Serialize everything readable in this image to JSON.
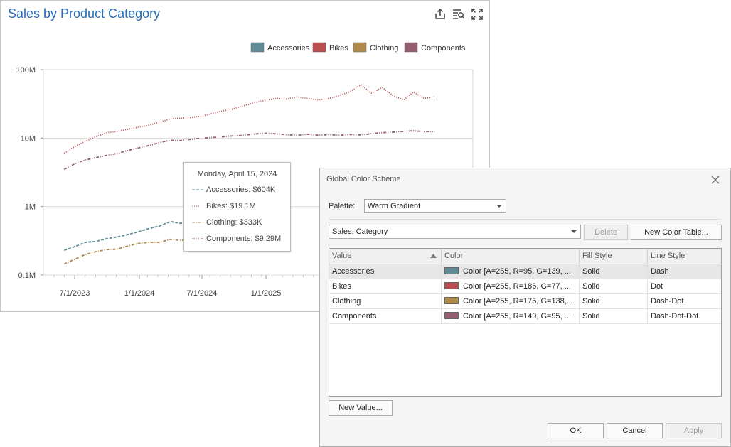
{
  "chart_panel": {
    "title": "Sales by Product Category",
    "icons": [
      "export-icon",
      "inspect-data-icon",
      "maximize-icon"
    ]
  },
  "chart_data": {
    "type": "line",
    "title": "Sales by Product Category",
    "y_scale": "log",
    "ylim": [
      100000,
      100000000
    ],
    "y_ticks": [
      {
        "value": 100000,
        "label": "0.1M"
      },
      {
        "value": 1000000,
        "label": "1M"
      },
      {
        "value": 10000000,
        "label": "10M"
      },
      {
        "value": 100000000,
        "label": "100M"
      }
    ],
    "x_ticks": [
      "7/1/2023",
      "1/1/2024",
      "7/1/2024",
      "1/1/2025"
    ],
    "grid": true,
    "legend_placement": "top-right",
    "series": [
      {
        "name": "Accessories",
        "color": "#5f8c96",
        "dash": "dash",
        "points": [
          [
            "2023-06-01",
            230000
          ],
          [
            "2023-07-01",
            260000
          ],
          [
            "2023-08-01",
            300000
          ],
          [
            "2023-09-01",
            310000
          ],
          [
            "2023-10-01",
            340000
          ],
          [
            "2023-11-01",
            360000
          ],
          [
            "2023-12-01",
            390000
          ],
          [
            "2024-01-01",
            430000
          ],
          [
            "2024-02-01",
            480000
          ],
          [
            "2024-03-01",
            520000
          ],
          [
            "2024-04-01",
            604000
          ],
          [
            "2024-05-01",
            570000
          ],
          [
            "2024-06-01",
            610000
          ],
          [
            "2024-07-01",
            640000
          ]
        ]
      },
      {
        "name": "Bikes",
        "color": "#ba4d4f",
        "dash": "dot",
        "points": [
          [
            "2023-06-01",
            6000000
          ],
          [
            "2023-07-01",
            7500000
          ],
          [
            "2023-08-01",
            9000000
          ],
          [
            "2023-09-01",
            10500000
          ],
          [
            "2023-10-01",
            12000000
          ],
          [
            "2023-11-01",
            12500000
          ],
          [
            "2023-12-01",
            13500000
          ],
          [
            "2024-01-01",
            14500000
          ],
          [
            "2024-02-01",
            15500000
          ],
          [
            "2024-03-01",
            17000000
          ],
          [
            "2024-04-01",
            19100000
          ],
          [
            "2024-05-01",
            19500000
          ],
          [
            "2024-06-01",
            20000000
          ],
          [
            "2024-07-01",
            21000000
          ],
          [
            "2024-08-01",
            23000000
          ],
          [
            "2024-09-01",
            25000000
          ],
          [
            "2024-10-01",
            27000000
          ],
          [
            "2024-11-01",
            30000000
          ],
          [
            "2024-12-01",
            33000000
          ],
          [
            "2025-01-01",
            36000000
          ],
          [
            "2025-02-01",
            38000000
          ],
          [
            "2025-03-01",
            37000000
          ],
          [
            "2025-04-01",
            40000000
          ],
          [
            "2025-05-01",
            38000000
          ],
          [
            "2025-06-01",
            36000000
          ],
          [
            "2025-07-01",
            38000000
          ],
          [
            "2025-08-01",
            42000000
          ],
          [
            "2025-09-01",
            48000000
          ],
          [
            "2025-10-01",
            60000000
          ],
          [
            "2025-11-01",
            45000000
          ],
          [
            "2025-12-01",
            55000000
          ],
          [
            "2026-01-01",
            42000000
          ],
          [
            "2026-02-01",
            36000000
          ],
          [
            "2026-03-01",
            47000000
          ],
          [
            "2026-04-01",
            38000000
          ],
          [
            "2026-05-01",
            40000000
          ]
        ]
      },
      {
        "name": "Clothing",
        "color": "#af8a4b",
        "dash": "dash-dot",
        "points": [
          [
            "2023-06-01",
            145000
          ],
          [
            "2023-07-01",
            170000
          ],
          [
            "2023-08-01",
            200000
          ],
          [
            "2023-09-01",
            220000
          ],
          [
            "2023-10-01",
            235000
          ],
          [
            "2023-11-01",
            240000
          ],
          [
            "2023-12-01",
            265000
          ],
          [
            "2024-01-01",
            290000
          ],
          [
            "2024-02-01",
            300000
          ],
          [
            "2024-03-01",
            300000
          ],
          [
            "2024-04-01",
            333000
          ],
          [
            "2024-05-01",
            320000
          ],
          [
            "2024-06-01",
            330000
          ],
          [
            "2024-07-01",
            340000
          ],
          [
            "2025-01-01",
            1200000
          ],
          [
            "2025-02-01",
            1600000
          ],
          [
            "2025-03-01",
            2200000
          ]
        ]
      },
      {
        "name": "Components",
        "color": "#955f72",
        "dash": "dash-dot-dot",
        "points": [
          [
            "2023-06-01",
            3500000
          ],
          [
            "2023-07-01",
            4200000
          ],
          [
            "2023-08-01",
            4800000
          ],
          [
            "2023-09-01",
            5200000
          ],
          [
            "2023-10-01",
            5600000
          ],
          [
            "2023-11-01",
            6000000
          ],
          [
            "2023-12-01",
            6600000
          ],
          [
            "2024-01-01",
            7200000
          ],
          [
            "2024-02-01",
            7800000
          ],
          [
            "2024-03-01",
            8600000
          ],
          [
            "2024-04-01",
            9290000
          ],
          [
            "2024-05-01",
            9200000
          ],
          [
            "2024-06-01",
            9600000
          ],
          [
            "2024-07-01",
            10000000
          ],
          [
            "2024-08-01",
            10200000
          ],
          [
            "2024-09-01",
            10500000
          ],
          [
            "2024-10-01",
            10800000
          ],
          [
            "2024-11-01",
            11000000
          ],
          [
            "2024-12-01",
            11500000
          ],
          [
            "2025-01-01",
            11800000
          ],
          [
            "2025-02-01",
            11500000
          ],
          [
            "2025-03-01",
            11200000
          ],
          [
            "2025-04-01",
            11000000
          ],
          [
            "2025-05-01",
            11400000
          ],
          [
            "2025-06-01",
            11000000
          ],
          [
            "2025-07-01",
            11200000
          ],
          [
            "2025-08-01",
            11000000
          ],
          [
            "2025-09-01",
            11300000
          ],
          [
            "2025-10-01",
            11100000
          ],
          [
            "2025-11-01",
            11600000
          ],
          [
            "2025-12-01",
            12000000
          ],
          [
            "2026-01-01",
            12200000
          ],
          [
            "2026-02-01",
            12500000
          ],
          [
            "2026-03-01",
            12800000
          ],
          [
            "2026-04-01",
            12400000
          ],
          [
            "2026-05-01",
            12500000
          ]
        ]
      }
    ]
  },
  "tooltip": {
    "date": "Monday, April 15, 2024",
    "rows": [
      {
        "series": "Accessories",
        "text": "Accessories: $604K"
      },
      {
        "series": "Bikes",
        "text": "Bikes: $19.1M"
      },
      {
        "series": "Clothing",
        "text": "Clothing: $333K"
      },
      {
        "series": "Components",
        "text": "Components: $9.29M"
      }
    ]
  },
  "dialog": {
    "title": "Global Color Scheme",
    "palette_label": "Palette:",
    "palette_value": "Warm Gradient",
    "dimension_value": "Sales: Category",
    "delete_label": "Delete",
    "new_color_table_label": "New Color Table...",
    "columns": [
      "Value",
      "Color",
      "Fill Style",
      "Line Style"
    ],
    "rows": [
      {
        "value": "Accessories",
        "color_text": "Color [A=255, R=95, G=139, ...",
        "swatch": "#5f8c96",
        "fill": "Solid",
        "line": "Dash",
        "selected": true
      },
      {
        "value": "Bikes",
        "color_text": "Color [A=255, R=186, G=77, ...",
        "swatch": "#ba4d4f",
        "fill": "Solid",
        "line": "Dot",
        "selected": false
      },
      {
        "value": "Clothing",
        "color_text": "Color [A=255, R=175, G=138,...",
        "swatch": "#af8a4b",
        "fill": "Solid",
        "line": "Dash-Dot",
        "selected": false
      },
      {
        "value": "Components",
        "color_text": "Color [A=255, R=149, G=95, ...",
        "swatch": "#955f72",
        "fill": "Solid",
        "line": "Dash-Dot-Dot",
        "selected": false
      }
    ],
    "new_value_label": "New Value...",
    "ok_label": "OK",
    "cancel_label": "Cancel",
    "apply_label": "Apply"
  }
}
